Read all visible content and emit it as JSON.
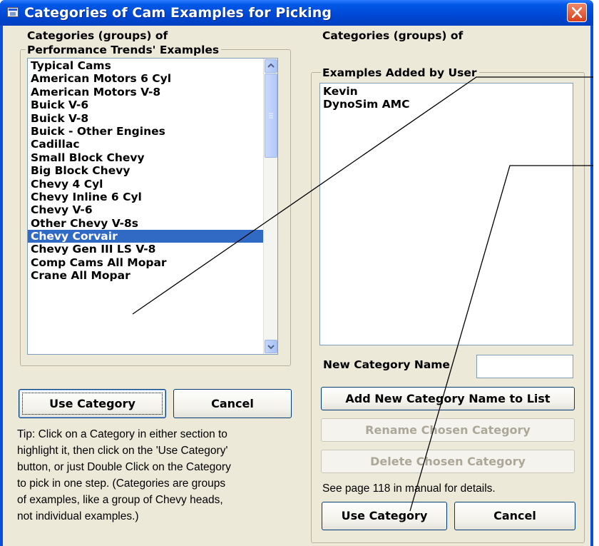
{
  "window": {
    "title": "Categories of Cam Examples for Picking"
  },
  "left_group": {
    "label_line1": "Categories (groups) of",
    "label_line2": "Performance Trends' Examples",
    "items": [
      "Typical Cams",
      "American Motors 6 Cyl",
      "American Motors V-8",
      "Buick V-6",
      "Buick V-8",
      "Buick - Other Engines",
      "Cadillac",
      "Small Block Chevy",
      "Big Block Chevy",
      "Chevy 4 Cyl",
      "Chevy Inline 6 Cyl",
      "Chevy V-6",
      "Other Chevy V-8s",
      "Chevy Corvair",
      "Chevy Gen III LS V-8",
      "Comp Cams All Mopar",
      "Crane All Mopar"
    ],
    "selected_item": "Chevy Corvair"
  },
  "right_group": {
    "label_line1": "Categories (groups) of",
    "label_line2": "Examples Added by User",
    "items": [
      "Kevin",
      "DynoSim AMC"
    ]
  },
  "left_buttons": {
    "use_category": "Use Category",
    "cancel": "Cancel"
  },
  "tip": {
    "line1": "Tip:  Click on a Category in either section to",
    "line2": "highlight it, then click on the 'Use Category'",
    "line3": "button, or just Double Click on the Category",
    "line4": "to pick in one step.  (Categories are groups",
    "line5": "of examples, like a group of Chevy heads,",
    "line6": "not individual examples.)"
  },
  "right_controls": {
    "new_category_label": "New Category Name",
    "new_category_value": "",
    "add_button": "Add New Category Name to List",
    "rename_button": "Rename Chosen Category",
    "delete_button": "Delete Chosen Category",
    "manual_note": "See page 118 in manual for details.",
    "use_category": "Use Category",
    "cancel": "Cancel"
  },
  "colors": {
    "titlebar": "#0054e3",
    "dialog_bg": "#ece9d8",
    "selection": "#316ac5",
    "disabled_text": "#aca899"
  }
}
